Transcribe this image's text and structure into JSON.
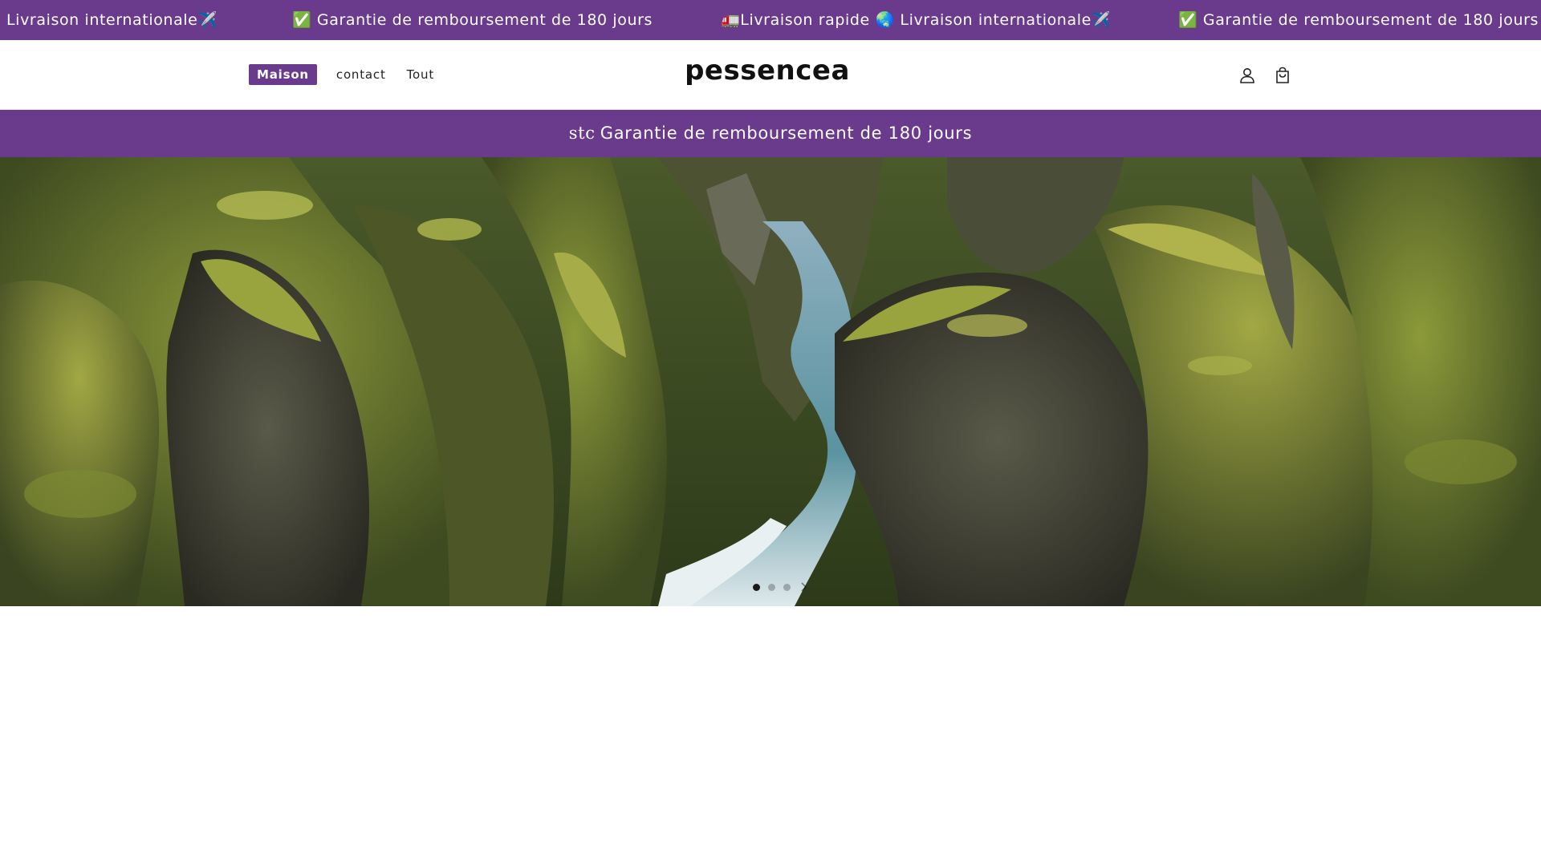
{
  "marquee": {
    "items": [
      "Livraison internationale✈️",
      "✅ Garantie de remboursement de 180 jours",
      "🚛Livraison rapide 🌏 Livraison internationale✈️",
      "✅ Garantie de remboursement de 180 jours"
    ]
  },
  "header": {
    "nav": [
      "Maison",
      "contact",
      "Tout"
    ],
    "logo": "pessencea",
    "icons": [
      "account-icon",
      "cart-icon"
    ]
  },
  "announcement": {
    "prefix": "stc",
    "text": "Garantie de remboursement de 180 jours"
  },
  "hero": {
    "image": "mossy-canyon-river-photo",
    "slides": 3,
    "active_slide": 1
  },
  "colors": {
    "brand": "#6a3a8c",
    "text": "#111111",
    "background": "#ffffff"
  }
}
